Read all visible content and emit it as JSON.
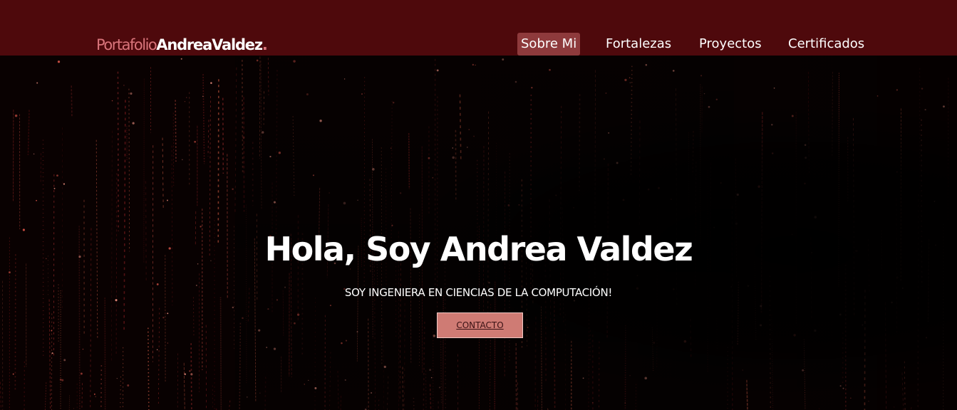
{
  "header": {
    "logo_part1": "Portafolio",
    "logo_part2": "AndreaValdez",
    "logo_dot": ".",
    "nav": [
      {
        "label": "Sobre Mi",
        "active": true
      },
      {
        "label": "Fortalezas",
        "active": false
      },
      {
        "label": "Proyectos",
        "active": false
      },
      {
        "label": "Certificados",
        "active": false
      }
    ]
  },
  "hero": {
    "title": "Hola, Soy Andrea Valdez",
    "subtitle": "SOY INGENIERA EN CIENCIAS DE LA COMPUTACIÓN!",
    "cta_label": "CONTACTO"
  },
  "colors": {
    "header_bg": "#4e090c",
    "accent": "#d9747a",
    "nav_active_bg": "#8e3a3c",
    "cta_bg": "#cf7b74"
  }
}
